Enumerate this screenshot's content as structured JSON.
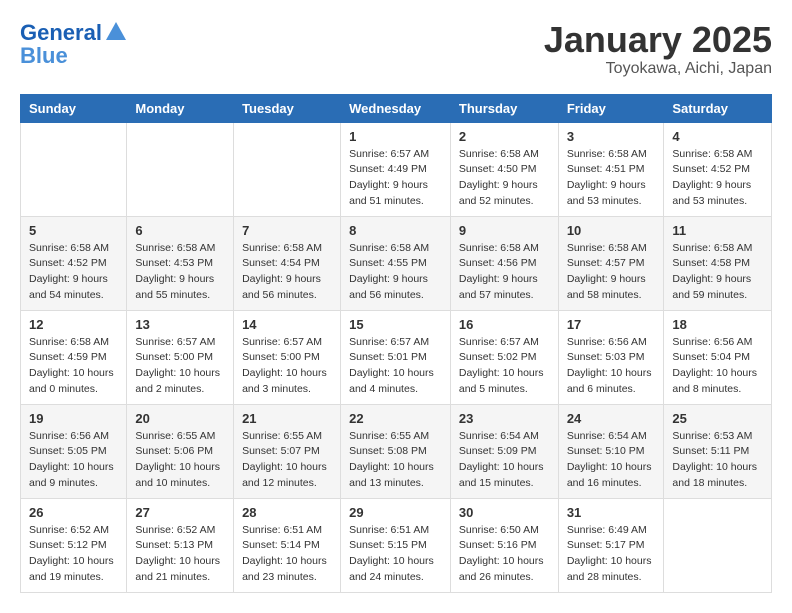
{
  "header": {
    "logo_text_general": "General",
    "logo_text_blue": "Blue",
    "month_title": "January 2025",
    "location": "Toyokawa, Aichi, Japan"
  },
  "weekdays": [
    "Sunday",
    "Monday",
    "Tuesday",
    "Wednesday",
    "Thursday",
    "Friday",
    "Saturday"
  ],
  "weeks": [
    [
      {
        "day": "",
        "info": ""
      },
      {
        "day": "",
        "info": ""
      },
      {
        "day": "",
        "info": ""
      },
      {
        "day": "1",
        "info": "Sunrise: 6:57 AM\nSunset: 4:49 PM\nDaylight: 9 hours\nand 51 minutes."
      },
      {
        "day": "2",
        "info": "Sunrise: 6:58 AM\nSunset: 4:50 PM\nDaylight: 9 hours\nand 52 minutes."
      },
      {
        "day": "3",
        "info": "Sunrise: 6:58 AM\nSunset: 4:51 PM\nDaylight: 9 hours\nand 53 minutes."
      },
      {
        "day": "4",
        "info": "Sunrise: 6:58 AM\nSunset: 4:52 PM\nDaylight: 9 hours\nand 53 minutes."
      }
    ],
    [
      {
        "day": "5",
        "info": "Sunrise: 6:58 AM\nSunset: 4:52 PM\nDaylight: 9 hours\nand 54 minutes."
      },
      {
        "day": "6",
        "info": "Sunrise: 6:58 AM\nSunset: 4:53 PM\nDaylight: 9 hours\nand 55 minutes."
      },
      {
        "day": "7",
        "info": "Sunrise: 6:58 AM\nSunset: 4:54 PM\nDaylight: 9 hours\nand 56 minutes."
      },
      {
        "day": "8",
        "info": "Sunrise: 6:58 AM\nSunset: 4:55 PM\nDaylight: 9 hours\nand 56 minutes."
      },
      {
        "day": "9",
        "info": "Sunrise: 6:58 AM\nSunset: 4:56 PM\nDaylight: 9 hours\nand 57 minutes."
      },
      {
        "day": "10",
        "info": "Sunrise: 6:58 AM\nSunset: 4:57 PM\nDaylight: 9 hours\nand 58 minutes."
      },
      {
        "day": "11",
        "info": "Sunrise: 6:58 AM\nSunset: 4:58 PM\nDaylight: 9 hours\nand 59 minutes."
      }
    ],
    [
      {
        "day": "12",
        "info": "Sunrise: 6:58 AM\nSunset: 4:59 PM\nDaylight: 10 hours\nand 0 minutes."
      },
      {
        "day": "13",
        "info": "Sunrise: 6:57 AM\nSunset: 5:00 PM\nDaylight: 10 hours\nand 2 minutes."
      },
      {
        "day": "14",
        "info": "Sunrise: 6:57 AM\nSunset: 5:00 PM\nDaylight: 10 hours\nand 3 minutes."
      },
      {
        "day": "15",
        "info": "Sunrise: 6:57 AM\nSunset: 5:01 PM\nDaylight: 10 hours\nand 4 minutes."
      },
      {
        "day": "16",
        "info": "Sunrise: 6:57 AM\nSunset: 5:02 PM\nDaylight: 10 hours\nand 5 minutes."
      },
      {
        "day": "17",
        "info": "Sunrise: 6:56 AM\nSunset: 5:03 PM\nDaylight: 10 hours\nand 6 minutes."
      },
      {
        "day": "18",
        "info": "Sunrise: 6:56 AM\nSunset: 5:04 PM\nDaylight: 10 hours\nand 8 minutes."
      }
    ],
    [
      {
        "day": "19",
        "info": "Sunrise: 6:56 AM\nSunset: 5:05 PM\nDaylight: 10 hours\nand 9 minutes."
      },
      {
        "day": "20",
        "info": "Sunrise: 6:55 AM\nSunset: 5:06 PM\nDaylight: 10 hours\nand 10 minutes."
      },
      {
        "day": "21",
        "info": "Sunrise: 6:55 AM\nSunset: 5:07 PM\nDaylight: 10 hours\nand 12 minutes."
      },
      {
        "day": "22",
        "info": "Sunrise: 6:55 AM\nSunset: 5:08 PM\nDaylight: 10 hours\nand 13 minutes."
      },
      {
        "day": "23",
        "info": "Sunrise: 6:54 AM\nSunset: 5:09 PM\nDaylight: 10 hours\nand 15 minutes."
      },
      {
        "day": "24",
        "info": "Sunrise: 6:54 AM\nSunset: 5:10 PM\nDaylight: 10 hours\nand 16 minutes."
      },
      {
        "day": "25",
        "info": "Sunrise: 6:53 AM\nSunset: 5:11 PM\nDaylight: 10 hours\nand 18 minutes."
      }
    ],
    [
      {
        "day": "26",
        "info": "Sunrise: 6:52 AM\nSunset: 5:12 PM\nDaylight: 10 hours\nand 19 minutes."
      },
      {
        "day": "27",
        "info": "Sunrise: 6:52 AM\nSunset: 5:13 PM\nDaylight: 10 hours\nand 21 minutes."
      },
      {
        "day": "28",
        "info": "Sunrise: 6:51 AM\nSunset: 5:14 PM\nDaylight: 10 hours\nand 23 minutes."
      },
      {
        "day": "29",
        "info": "Sunrise: 6:51 AM\nSunset: 5:15 PM\nDaylight: 10 hours\nand 24 minutes."
      },
      {
        "day": "30",
        "info": "Sunrise: 6:50 AM\nSunset: 5:16 PM\nDaylight: 10 hours\nand 26 minutes."
      },
      {
        "day": "31",
        "info": "Sunrise: 6:49 AM\nSunset: 5:17 PM\nDaylight: 10 hours\nand 28 minutes."
      },
      {
        "day": "",
        "info": ""
      }
    ]
  ]
}
